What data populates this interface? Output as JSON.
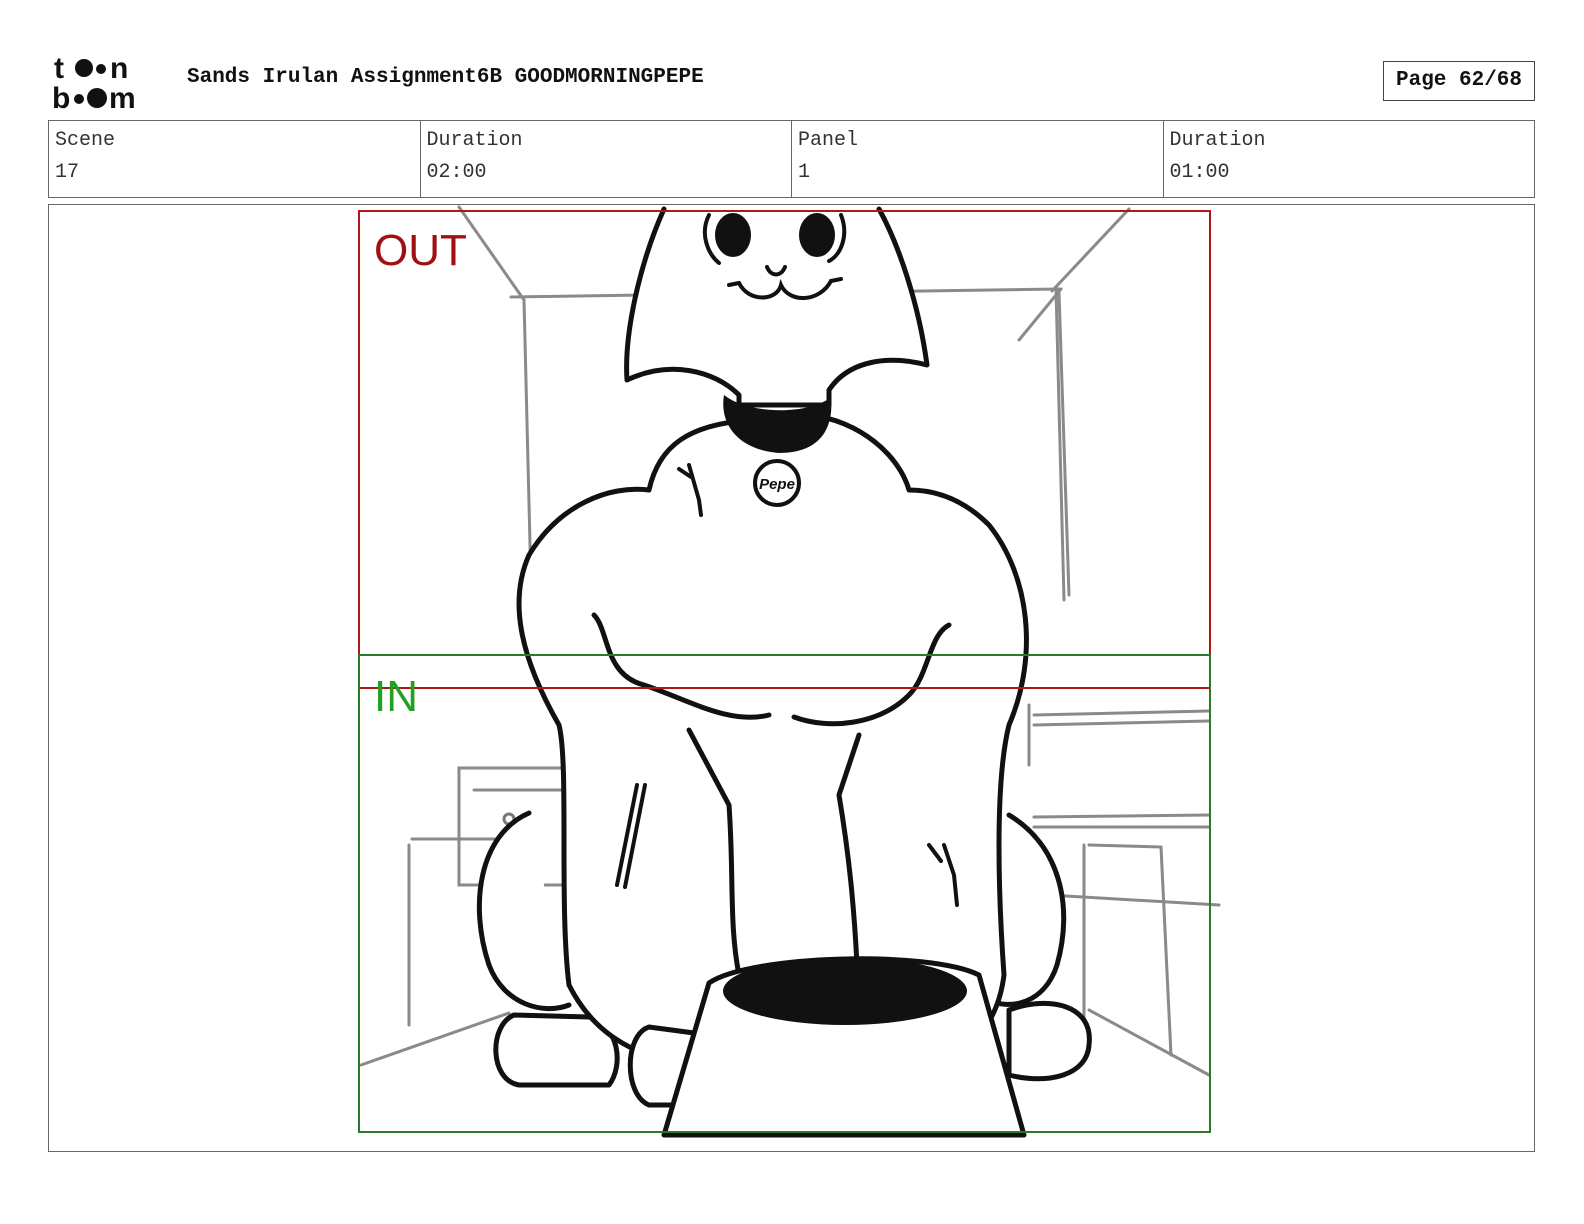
{
  "header": {
    "logo_text": "toon boom",
    "title": "Sands Irulan Assignment6B GOODMORNINGPEPE",
    "page": "Page 62/68"
  },
  "info": {
    "scene_label": "Scene",
    "scene_value": "17",
    "scene_duration_label": "Duration",
    "scene_duration_value": "02:00",
    "panel_label": "Panel",
    "panel_value": "1",
    "panel_duration_label": "Duration",
    "panel_duration_value": "01:00"
  },
  "panel": {
    "out_label": "OUT",
    "in_label": "IN",
    "out_color": "#a01010",
    "in_color": "#22a022",
    "tag_text": "Pepe"
  }
}
